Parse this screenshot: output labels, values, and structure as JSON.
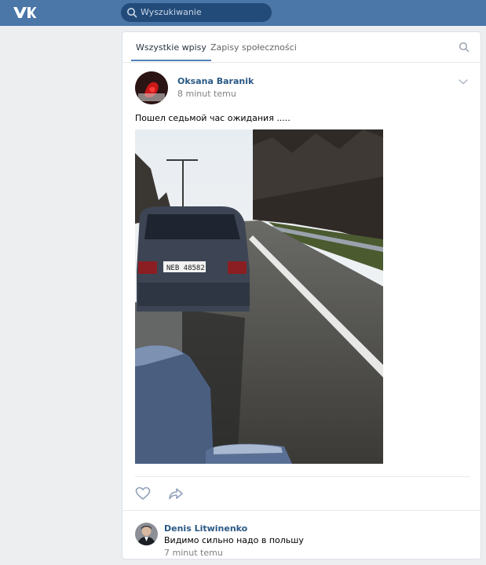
{
  "header": {
    "logo_icon": "vk-logo-icon",
    "search_placeholder": "Wyszukiwanie"
  },
  "tabs": {
    "all_posts": "Wszystkie wpisy",
    "community_posts": "Zapisy społeczności"
  },
  "post": {
    "author": "Oksana Baranik",
    "time": "8 minut temu",
    "text": "Пошел седьмой час ожидания .....",
    "photo": "photo of a line of cars queued on a road, license plate NEB 48582",
    "plate_text": "NEB 48582"
  },
  "actions": {
    "like_icon": "heart-icon",
    "share_icon": "share-icon"
  },
  "comment": {
    "author": "Denis Litwinenko",
    "text": "Видимо сильно надо в польшу",
    "time": "7 minut temu"
  },
  "colors": {
    "header": "#4a76a8",
    "link": "#2a5885",
    "accent": "#5181b8"
  }
}
